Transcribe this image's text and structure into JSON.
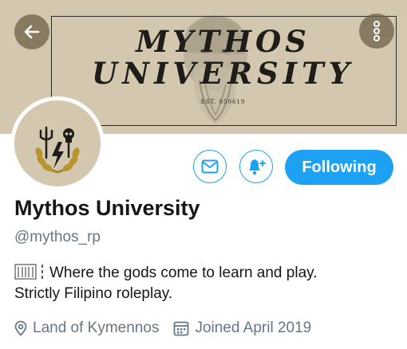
{
  "banner": {
    "title_line1": "MYTHOS",
    "title_line2": "UNIVERSITY",
    "est_text": "EST. 050619"
  },
  "profile": {
    "name": "Mythos University",
    "handle": "@mythos_rp",
    "bio_line1": "Where the gods come to learn and play.",
    "bio_line2": "Strictly Filipino roleplay.",
    "location": "Land of Kymennos",
    "joined": "Joined April 2019"
  },
  "actions": {
    "follow_label": "Following",
    "message_icon": "mail-icon",
    "notify_icon": "bell-plus-icon"
  },
  "colors": {
    "accent": "#1da1f2",
    "secondary_text": "#657786",
    "banner_bg": "#d3c8af"
  }
}
